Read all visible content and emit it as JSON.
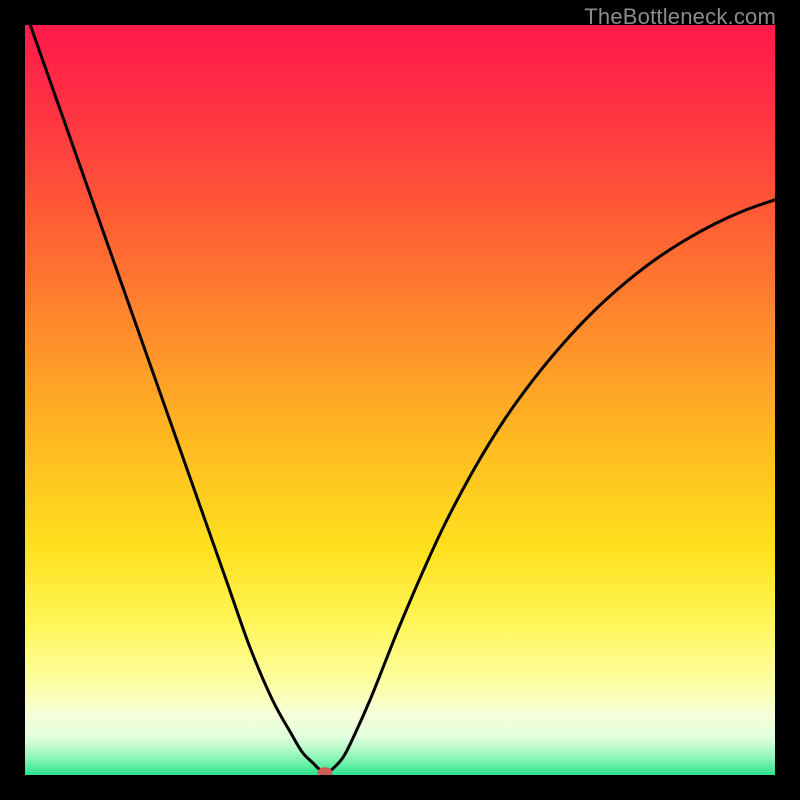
{
  "attribution": "TheBottleneck.com",
  "colors": {
    "bg": "#000000",
    "attribText": "#8b8b8b",
    "curve": "#000000",
    "marker": "#cf5b54",
    "gradientStops": [
      {
        "offset": 0.0,
        "color": "#ff1a4a"
      },
      {
        "offset": 0.1,
        "color": "#ff2f44"
      },
      {
        "offset": 0.25,
        "color": "#ff5a36"
      },
      {
        "offset": 0.4,
        "color": "#ff8a2c"
      },
      {
        "offset": 0.55,
        "color": "#ffb822"
      },
      {
        "offset": 0.7,
        "color": "#ffe11e"
      },
      {
        "offset": 0.8,
        "color": "#fff65a"
      },
      {
        "offset": 0.88,
        "color": "#fdffa6"
      },
      {
        "offset": 0.92,
        "color": "#f7ffda"
      },
      {
        "offset": 0.95,
        "color": "#dfffdc"
      },
      {
        "offset": 0.975,
        "color": "#96f7ba"
      },
      {
        "offset": 1.0,
        "color": "#2be28e"
      }
    ]
  },
  "chart_data": {
    "type": "line",
    "title": "",
    "xlabel": "",
    "ylabel": "",
    "xlim": [
      0,
      100
    ],
    "ylim": [
      0,
      100
    ],
    "grid": false,
    "legend": false,
    "annotations": [],
    "series": [
      {
        "name": "bottleneck-curve",
        "x": [
          0,
          3,
          6,
          9,
          12,
          15,
          18,
          21,
          24,
          27,
          30,
          33,
          35.5,
          37,
          38.5,
          39.2,
          40,
          41,
          42.5,
          44,
          46,
          48,
          50,
          53,
          56,
          60,
          64,
          68,
          72,
          76,
          80,
          84,
          88,
          92,
          96,
          100
        ],
        "y": [
          102,
          93.5,
          85,
          76.5,
          68,
          59.5,
          51,
          42.5,
          34,
          25.5,
          17,
          10,
          5.5,
          3,
          1.5,
          0.8,
          0.3,
          0.8,
          2.5,
          5.5,
          10,
          15,
          20,
          27,
          33.5,
          41,
          47.5,
          53,
          57.8,
          62,
          65.6,
          68.7,
          71.3,
          73.5,
          75.3,
          76.7
        ]
      }
    ],
    "marker": {
      "x": 40,
      "y": 0.3,
      "rx": 5.5,
      "ry": 4.2
    }
  }
}
